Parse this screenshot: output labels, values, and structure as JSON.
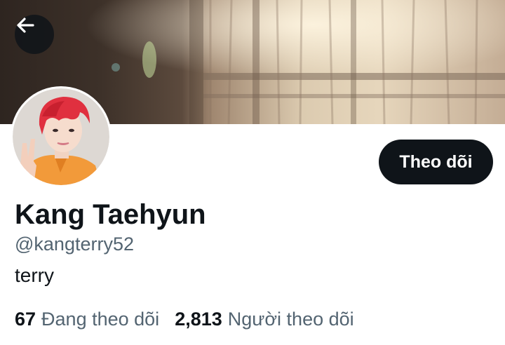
{
  "header": {
    "back_icon": "arrow-left-icon"
  },
  "profile": {
    "avatar_icon": "profile-photo",
    "display_name": "Kang Taehyun",
    "handle": "@kangterry52",
    "bio": "terry",
    "follow_label": "Theo dõi"
  },
  "stats": [
    {
      "count": "67",
      "label": "Đang theo dõi"
    },
    {
      "count": "2,813",
      "label": "Người theo dõi"
    }
  ],
  "colors": {
    "primary_text": "#0f1419",
    "secondary_text": "#536471",
    "button_bg": "#0f1419",
    "button_text": "#ffffff",
    "avatar_hair": "#e0303f",
    "avatar_jacket": "#f29a3a"
  }
}
